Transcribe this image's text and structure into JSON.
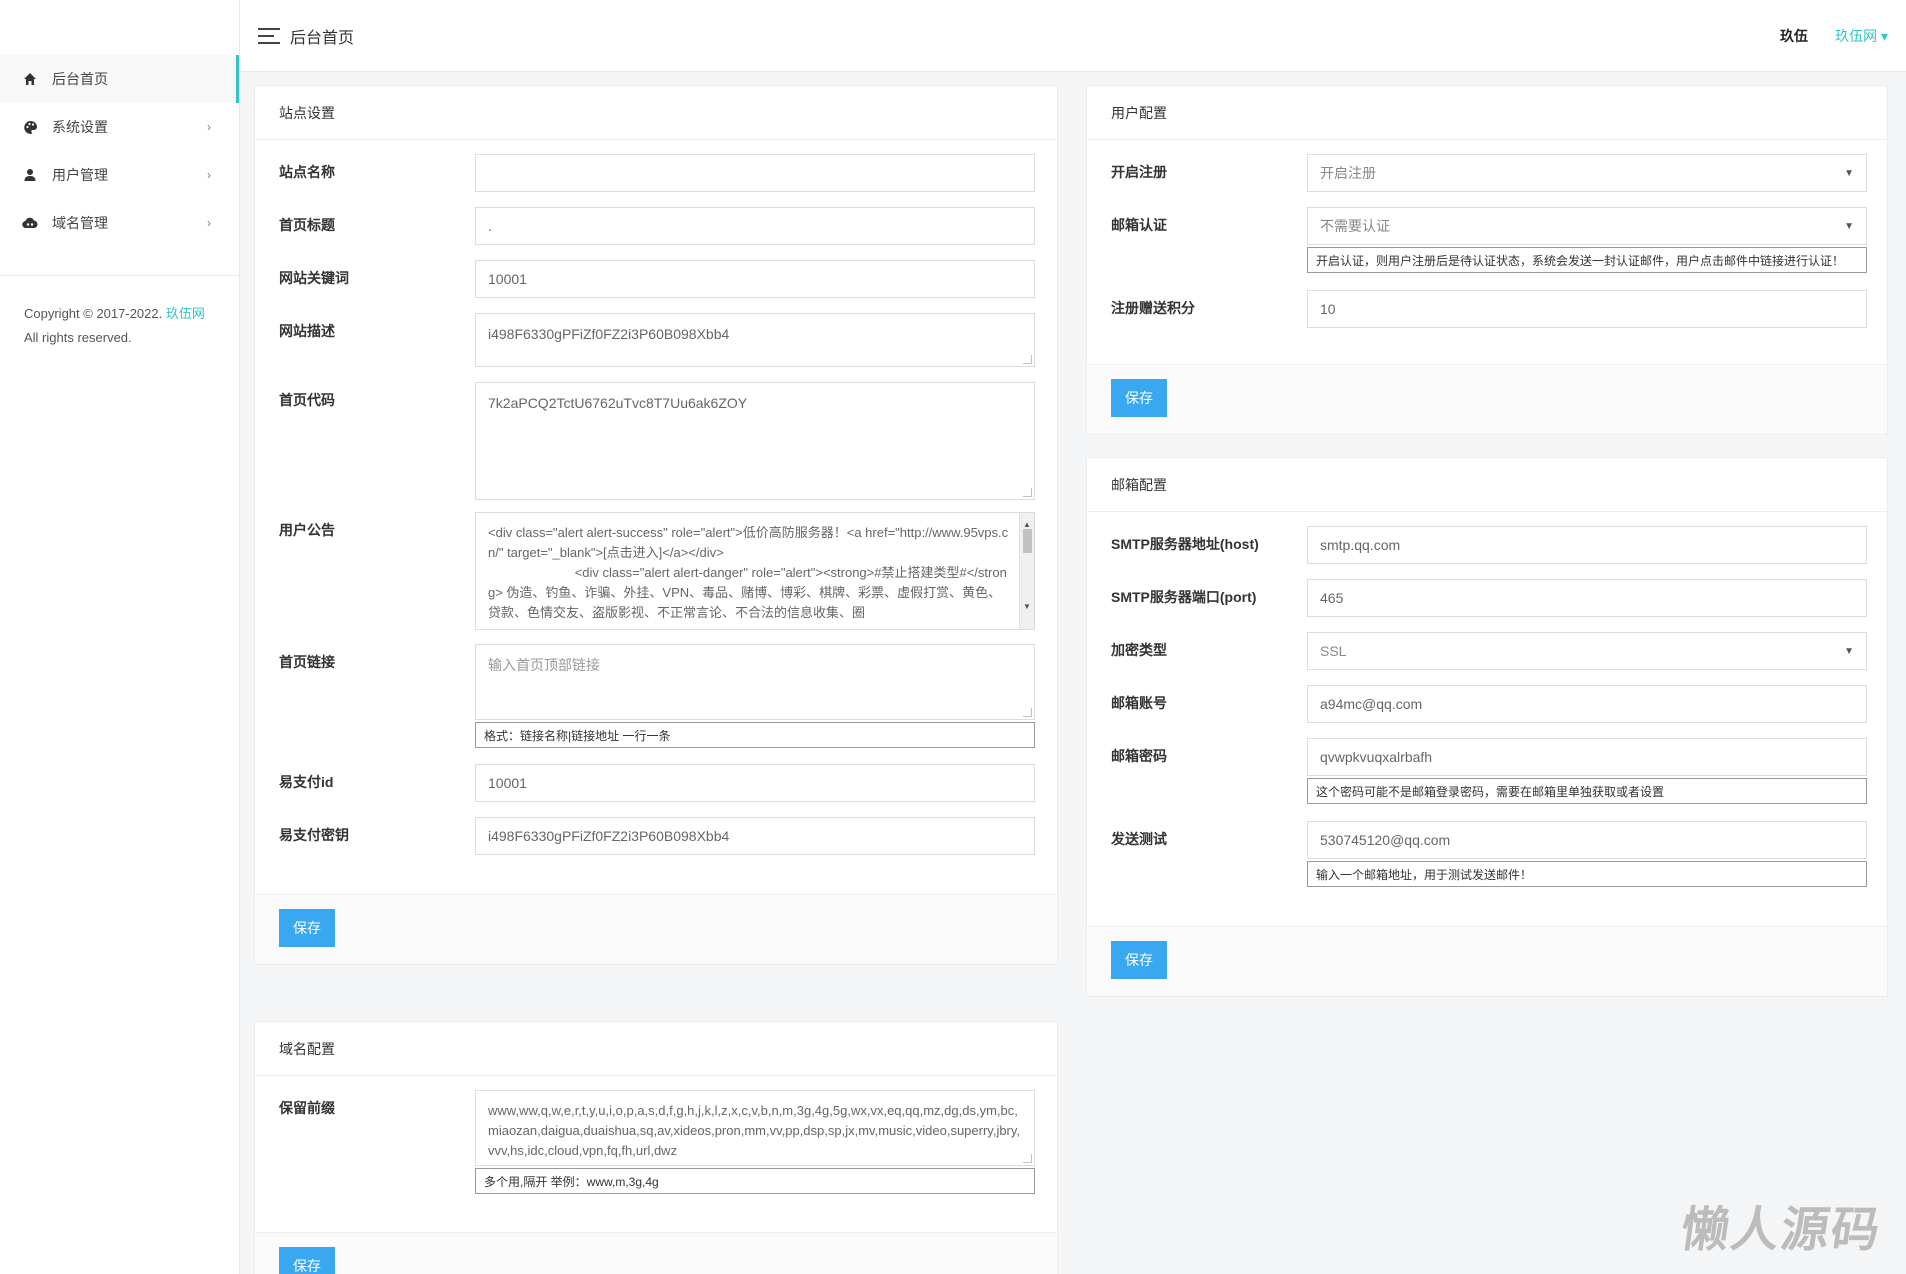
{
  "app": {
    "title": "后台首页"
  },
  "sidebar": {
    "items": [
      {
        "label": "后台首页",
        "icon": "home-icon"
      },
      {
        "label": "系统设置",
        "icon": "palette-icon",
        "arrow": "›"
      },
      {
        "label": "用户管理",
        "icon": "user-icon",
        "arrow": "›"
      },
      {
        "label": "域名管理",
        "icon": "cloud-icon",
        "arrow": "›"
      }
    ],
    "copyright_prefix": "Copyright © 2017-2022.",
    "copyright_brand": "玖伍网",
    "copyright_suffix": "All rights reserved."
  },
  "header": {
    "title": "后台首页",
    "user": "玖伍",
    "site": "玖伍网 ▾"
  },
  "site_settings": {
    "title": "站点设置",
    "site_name_label": "站点名称",
    "site_name_value": "",
    "home_title_label": "首页标题",
    "home_title_value": ".",
    "keywords_label": "网站关键词",
    "keywords_value": "10001",
    "description_label": "网站描述",
    "description_value": "i498F6330gPFiZf0FZ2i3P60B098Xbb4",
    "home_code_label": "首页代码",
    "home_code_value": "7k2aPCQ2TctU6762uTvc8T7Uu6ak6ZOY",
    "notice_label": "用户公告",
    "notice_value": "<div class=\"alert alert-success\" role=\"alert\">低价高防服务器！<a href=\"http://www.95vps.cn/\" target=\"_blank\">[点击进入]</a></div>\n                        <div class=\"alert alert-danger\" role=\"alert\"><strong>#禁止搭建类型#</strong> 伪造、钓鱼、诈骗、外挂、VPN、毒品、赌博、博彩、棋牌、彩票、虚假打赏、黄色、贷款、色情交友、盗版影视、不正常言论、不合法的信息收集、圈",
    "home_links_label": "首页链接",
    "home_links_placeholder": "输入首页顶部链接",
    "home_links_help": "格式：链接名称|链接地址 一行一条",
    "epay_id_label": "易支付id",
    "epay_id_value": "10001",
    "epay_key_label": "易支付密钥",
    "epay_key_value": "i498F6330gPFiZf0FZ2i3P60B098Xbb4",
    "save_label": "保存"
  },
  "user_config": {
    "title": "用户配置",
    "register_label": "开启注册",
    "register_value": "开启注册",
    "email_verify_label": "邮箱认证",
    "email_verify_value": "不需要认证",
    "email_verify_help": "开启认证，则用户注册后是待认证状态，系统会发送一封认证邮件，用户点击邮件中链接进行认证！",
    "bonus_label": "注册赠送积分",
    "bonus_value": "10",
    "save_label": "保存"
  },
  "mail_config": {
    "title": "邮箱配置",
    "host_label": "SMTP服务器地址(host)",
    "host_value": "smtp.qq.com",
    "port_label": "SMTP服务器端口(port)",
    "port_value": "465",
    "encrypt_label": "加密类型",
    "encrypt_value": "SSL",
    "account_label": "邮箱账号",
    "account_value": "a94mc@qq.com",
    "password_label": "邮箱密码",
    "password_value": "qvwpkvuqxalrbafh",
    "password_help": "这个密码可能不是邮箱登录密码，需要在邮箱里单独获取或者设置",
    "test_label": "发送测试",
    "test_value": "530745120@qq.com",
    "test_help": "输入一个邮箱地址，用于测试发送邮件！",
    "save_label": "保存"
  },
  "domain_config": {
    "title": "域名配置",
    "reserved_label": "保留前缀",
    "reserved_value": "www,ww,q,w,e,r,t,y,u,i,o,p,a,s,d,f,g,h,j,k,l,z,x,c,v,b,n,m,3g,4g,5g,wx,vx,eq,qq,mz,dg,ds,ym,bc,miaozan,daigua,duaishua,sq,av,xideos,pron,mm,vv,pp,dsp,sp,jx,mv,music,video,superry,jbry,vvv,hs,idc,cloud,vpn,fq,fh,url,dwz",
    "reserved_help": "多个用,隔开 举例：www,m,3g,4g",
    "save_label": "保存"
  },
  "watermark": "懒人源码"
}
